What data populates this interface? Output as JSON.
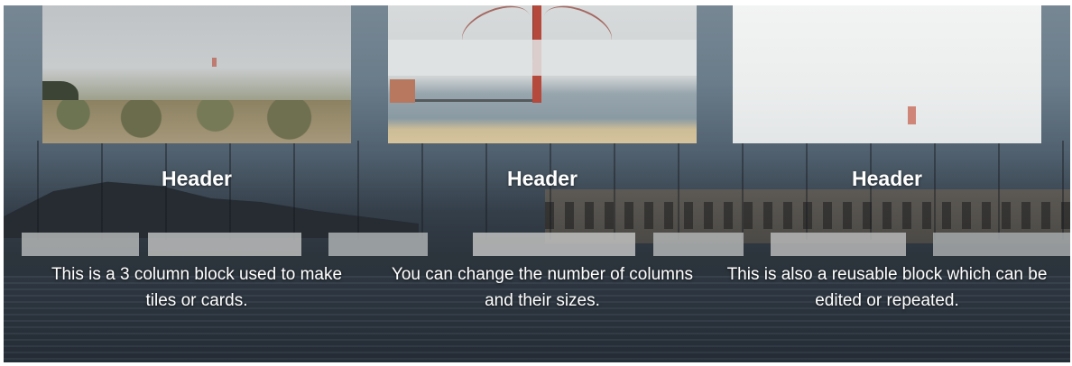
{
  "columns": [
    {
      "image": "fog-over-golden-gate-from-hillside",
      "header": "Header",
      "text": "This is a 3 column block used to make tiles or cards."
    },
    {
      "image": "golden-gate-tower-in-fog",
      "header": "Header",
      "text": "You can change the number of columns and their sizes."
    },
    {
      "image": "bridge-tower-hidden-in-fog",
      "header": "Header",
      "text": "This is also a reusable block which can be edited or repeated."
    }
  ],
  "background_image": "harbor-with-boats"
}
